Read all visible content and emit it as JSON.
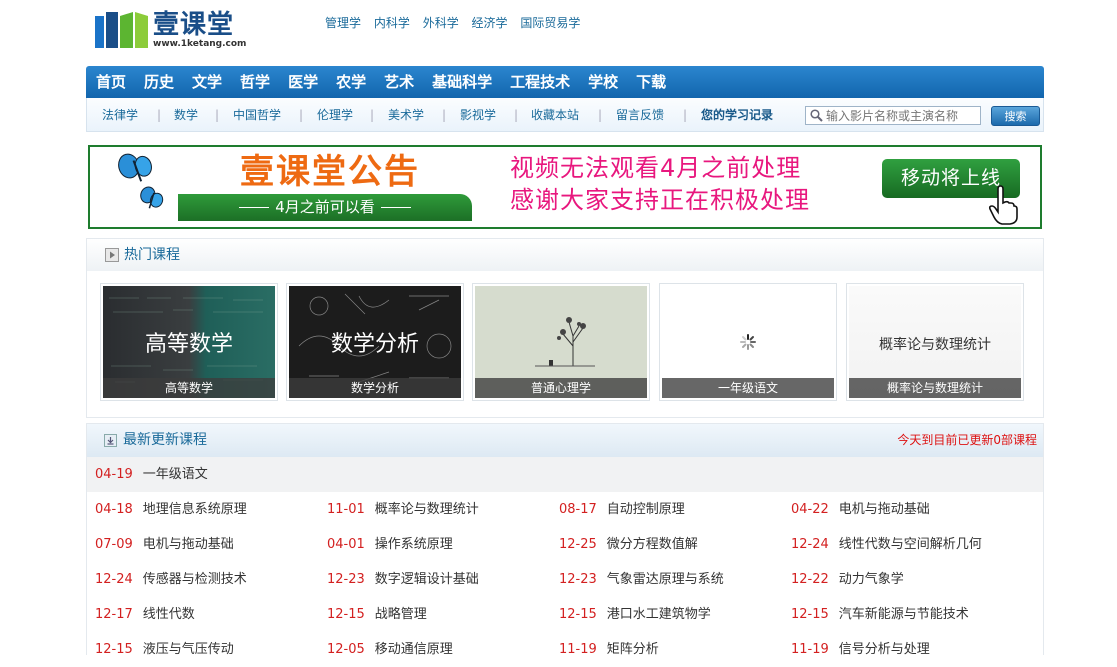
{
  "logo": {
    "name": "壹课堂",
    "domain": "www.1ketang.com"
  },
  "top_links": [
    "管理学",
    "内科学",
    "外科学",
    "经济学",
    "国际贸易学"
  ],
  "nav": [
    "首页",
    "历史",
    "文学",
    "哲学",
    "医学",
    "农学",
    "艺术",
    "基础科学",
    "工程技术",
    "学校",
    "下载"
  ],
  "subnav": [
    "法律学",
    "数学",
    "中国哲学",
    "伦理学",
    "美术学",
    "影视学",
    "收藏本站",
    "留言反馈",
    "您的学习记录"
  ],
  "search": {
    "placeholder": "输入影片名称或主演名称",
    "button": "搜索"
  },
  "banner": {
    "title": "壹课堂公告",
    "ribbon": "4月之前可以看",
    "line1": "视频无法观看4月之前处理",
    "line2": "感谢大家支持正在积极处理",
    "button": "移动将上线"
  },
  "hot": {
    "title": "热门课程",
    "courses": [
      {
        "overlay": "高等数学",
        "caption": "高等数学"
      },
      {
        "overlay": "数学分析",
        "caption": "数学分析"
      },
      {
        "overlay": "",
        "caption": "普通心理学"
      },
      {
        "overlay": "",
        "caption": "一年级语文"
      },
      {
        "overlay": "概率论与数理统计",
        "caption": "概率论与数理统计"
      }
    ]
  },
  "latest": {
    "title": "最新更新课程",
    "count_note": "今天到目前已更新0部课程",
    "first": {
      "date": "04-19",
      "name": "一年级语文"
    },
    "rows": [
      [
        {
          "date": "04-18",
          "name": "地理信息系统原理"
        },
        {
          "date": "11-01",
          "name": "概率论与数理统计"
        },
        {
          "date": "08-17",
          "name": "自动控制原理"
        },
        {
          "date": "04-22",
          "name": "电机与拖动基础"
        }
      ],
      [
        {
          "date": "07-09",
          "name": "电机与拖动基础"
        },
        {
          "date": "04-01",
          "name": "操作系统原理"
        },
        {
          "date": "12-25",
          "name": "微分方程数值解"
        },
        {
          "date": "12-24",
          "name": "线性代数与空间解析几何"
        }
      ],
      [
        {
          "date": "12-24",
          "name": "传感器与检测技术"
        },
        {
          "date": "12-23",
          "name": "数字逻辑设计基础"
        },
        {
          "date": "12-23",
          "name": "气象雷达原理与系统"
        },
        {
          "date": "12-22",
          "name": "动力气象学"
        }
      ],
      [
        {
          "date": "12-17",
          "name": "线性代数"
        },
        {
          "date": "12-15",
          "name": "战略管理"
        },
        {
          "date": "12-15",
          "name": "港口水工建筑物学"
        },
        {
          "date": "12-15",
          "name": "汽车新能源与节能技术"
        }
      ],
      [
        {
          "date": "12-15",
          "name": "液压与气压传动"
        },
        {
          "date": "12-05",
          "name": "移动通信原理"
        },
        {
          "date": "11-19",
          "name": "矩阵分析"
        },
        {
          "date": "11-19",
          "name": "信号分析与处理"
        }
      ]
    ]
  },
  "colors": {
    "nav_blue": "#1b72bd",
    "banner_green": "#1e7c2e",
    "date_red": "#d32020",
    "banner_pink": "#e8177e"
  }
}
